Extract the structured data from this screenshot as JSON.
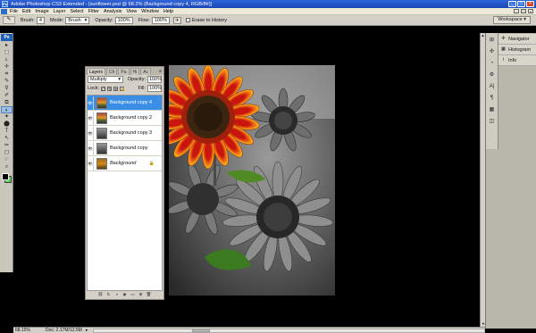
{
  "window": {
    "app_icon": "Ps",
    "title": "Adobe Photoshop CS3 Extended - [sunflower.psd @ 68.2% (Background copy 4, RGB/8#)]",
    "minimize": "_",
    "maximize": "□",
    "close": "×"
  },
  "menu": {
    "items": [
      "File",
      "Edit",
      "Image",
      "Layer",
      "Select",
      "Filter",
      "Analysis",
      "View",
      "Window",
      "Help"
    ],
    "doc_controls": [
      "_",
      "□",
      "×"
    ]
  },
  "options": {
    "tool_icon": "brush-icon",
    "brush_label": "Brush:",
    "brush_size": "4",
    "mode_label": "Mode:",
    "mode_value": "Brush",
    "opacity_label": "Opacity:",
    "opacity_value": "100%",
    "flow_label": "Flow:",
    "flow_value": "100%",
    "erase_history_label": "Erase to History",
    "workspace_label": "Workspace ▾"
  },
  "toolbox": {
    "logo": "Ps",
    "tools": [
      "▸",
      "⬚",
      "ʟ",
      "✛",
      "⌗",
      "✎",
      "⚲",
      "✐",
      "⧉",
      "◐",
      "✦",
      "⬤",
      "T",
      "↖",
      "✏",
      "◻",
      "☞",
      "⌕"
    ],
    "selected_index": 9,
    "foreground": "#000000",
    "background": "#5fd35a"
  },
  "layers_panel": {
    "tabs": [
      "Layers",
      "Ch",
      "Pa",
      "Hi",
      "Ac"
    ],
    "menu_glyph": "≡",
    "blend_mode": "Multiply",
    "opacity_label": "Opacity:",
    "opacity_value": "100%",
    "lock_label": "Lock:",
    "fill_label": "Fill:",
    "fill_value": "100%",
    "layers": [
      {
        "name": "Background copy 4",
        "selected": true,
        "italic": false,
        "thumb": "color",
        "eye": "👁"
      },
      {
        "name": "Background copy 2",
        "selected": false,
        "italic": false,
        "thumb": "color",
        "eye": "👁"
      },
      {
        "name": "Background copy 3",
        "selected": false,
        "italic": false,
        "thumb": "gray",
        "eye": "👁"
      },
      {
        "name": "Background copy",
        "selected": false,
        "italic": false,
        "thumb": "gray",
        "eye": "👁"
      },
      {
        "name": "Background",
        "selected": false,
        "italic": true,
        "thumb": "bg",
        "eye": "👁",
        "lock": "🔒"
      }
    ],
    "bottom_icons": [
      "⛓",
      "fx",
      "◑",
      "◉",
      "▭",
      "⊞",
      "🗑"
    ]
  },
  "dock": {
    "icons": [
      "⊞",
      "✣",
      "◔",
      "⚙",
      "A|",
      "¶",
      "▦",
      "◫"
    ],
    "panels": [
      {
        "icon": "✣",
        "label": "Navigator"
      },
      {
        "icon": "▦",
        "label": "Histogram"
      },
      {
        "icon": "i",
        "label": "Info"
      }
    ]
  },
  "status": {
    "zoom": "68.15%",
    "doc": "Doc: 2.17M/12.5M",
    "arrow": "▸"
  },
  "colors": {
    "selection_blue": "#3a8ee6",
    "canvas_bg": "#000000",
    "chrome": "#d4d0c8"
  }
}
